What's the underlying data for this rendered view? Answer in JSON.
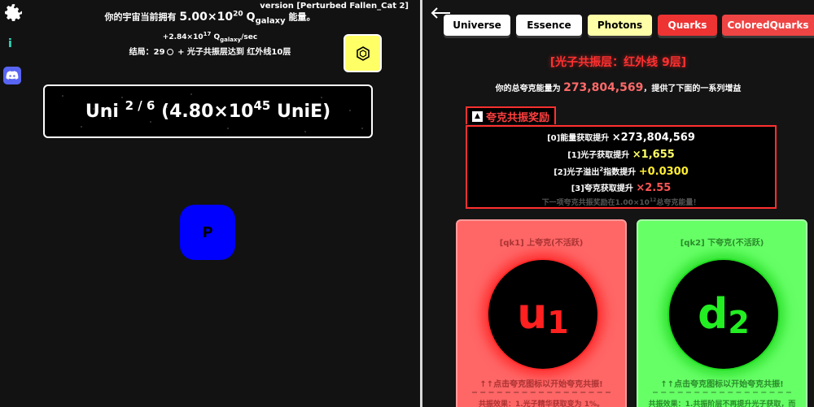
{
  "left": {
    "version": "version [Perturbed Fallen_Cat 2]",
    "energy": {
      "prefix": "你的宇宙当前拥有",
      "amount": "5.00×10",
      "exponent": "20",
      "unit": "Q",
      "unit_sub": "galaxy",
      "suffix": "能量。"
    },
    "rate": {
      "value": "+2.84×10",
      "exponent": "17",
      "unit": "Q",
      "unit_sub": "galaxy",
      "per": "/sec"
    },
    "ending": {
      "prefix": "结局：",
      "count": "29",
      "text": "+ 光子共振层达到 红外线10层"
    },
    "uni_box": {
      "name": "Uni",
      "progress": "2 / 6",
      "value": "(4.80×10",
      "exponent": "45",
      "unit": "UniE)"
    },
    "p_button": "P",
    "icons": {
      "settings": "gear-icon",
      "info": "info-icon",
      "discord": "discord-icon",
      "hex": "hexagon-icon"
    }
  },
  "right": {
    "tabs": [
      {
        "label": "Universe"
      },
      {
        "label": "Essence"
      },
      {
        "label": "Photons"
      },
      {
        "label": "Quarks"
      },
      {
        "label": "ColoredQuarks"
      }
    ],
    "resonance_title": "[光子共振层：红外线 9层]",
    "total": {
      "prefix": "你的总夸克能量为",
      "value": "273,804,569",
      "suffix": "，提供了下面的一系列增益"
    },
    "reward_header": "夸克共振奖励",
    "rewards": [
      {
        "label": "[0]能量获取提升",
        "value": "×273,804,569"
      },
      {
        "label": "[1]光子获取提升",
        "value": "×1,655"
      },
      {
        "label_a": "[2]光子溢出",
        "label_sup": "2",
        "label_b": "指数提升",
        "value": "+0.0300"
      },
      {
        "label": "[3]夸克获取提升",
        "value": "×2.55"
      }
    ],
    "next_reward": {
      "prefix": "下一项夸克共振奖励在1.00×10",
      "exponent": "12",
      "suffix": "总夸克能量！"
    },
    "cards": [
      {
        "label": "[qk1] 上夸克(不活跃)",
        "letter": "u",
        "index": "1",
        "hint": "↑↑点击夸克图标以开始夸克共振!",
        "effect": "共振效果：1.光子精华获取变为 1%。"
      },
      {
        "label": "[qk2] 下夸克(不活跃)",
        "letter": "d",
        "index": "2",
        "hint": "↑↑点击夸克图标以开始夸克共振!",
        "effect": "共振效果：1.共振阶层不再提升光子获取，而"
      }
    ],
    "colors": {
      "accent_red": "#ff3030",
      "quark_up": "#ff6666",
      "quark_down": "#66ff66",
      "photon_yellow": "#ffff66"
    }
  }
}
